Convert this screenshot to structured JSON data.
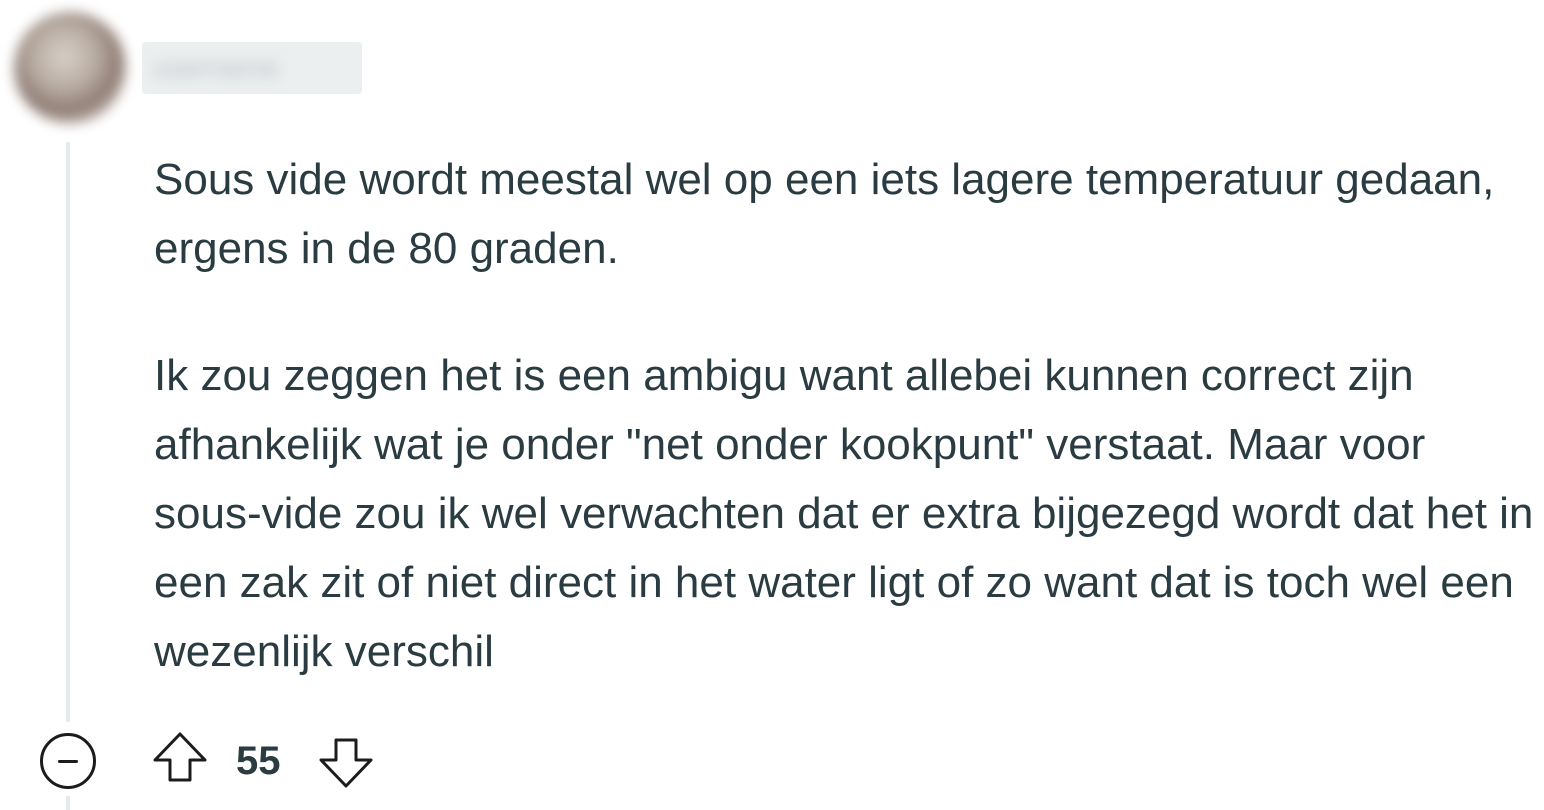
{
  "comment": {
    "author": "username",
    "paragraphs": [
      "Sous vide wordt meestal wel op een iets lagere temperatuur gedaan, ergens in de 80 graden.",
      "Ik zou zeggen het is een ambigu want allebei kunnen correct zijn afhankelijk wat je onder \"net onder kookpunt\" verstaat. Maar voor sous-vide zou ik wel verwachten dat er extra bijgezegd wordt dat het in een zak zit of niet direct in het water ligt of zo want dat is toch wel een wezenlijk verschil"
    ],
    "vote_count": "55"
  },
  "icons": {
    "collapse": "collapse-minus-circle-icon",
    "upvote": "arrow-up-outline-icon",
    "downvote": "arrow-down-outline-icon"
  },
  "colors": {
    "text": "#2a3c42",
    "thread_line": "#e5ebee",
    "icon_stroke": "#1c1c1c"
  }
}
